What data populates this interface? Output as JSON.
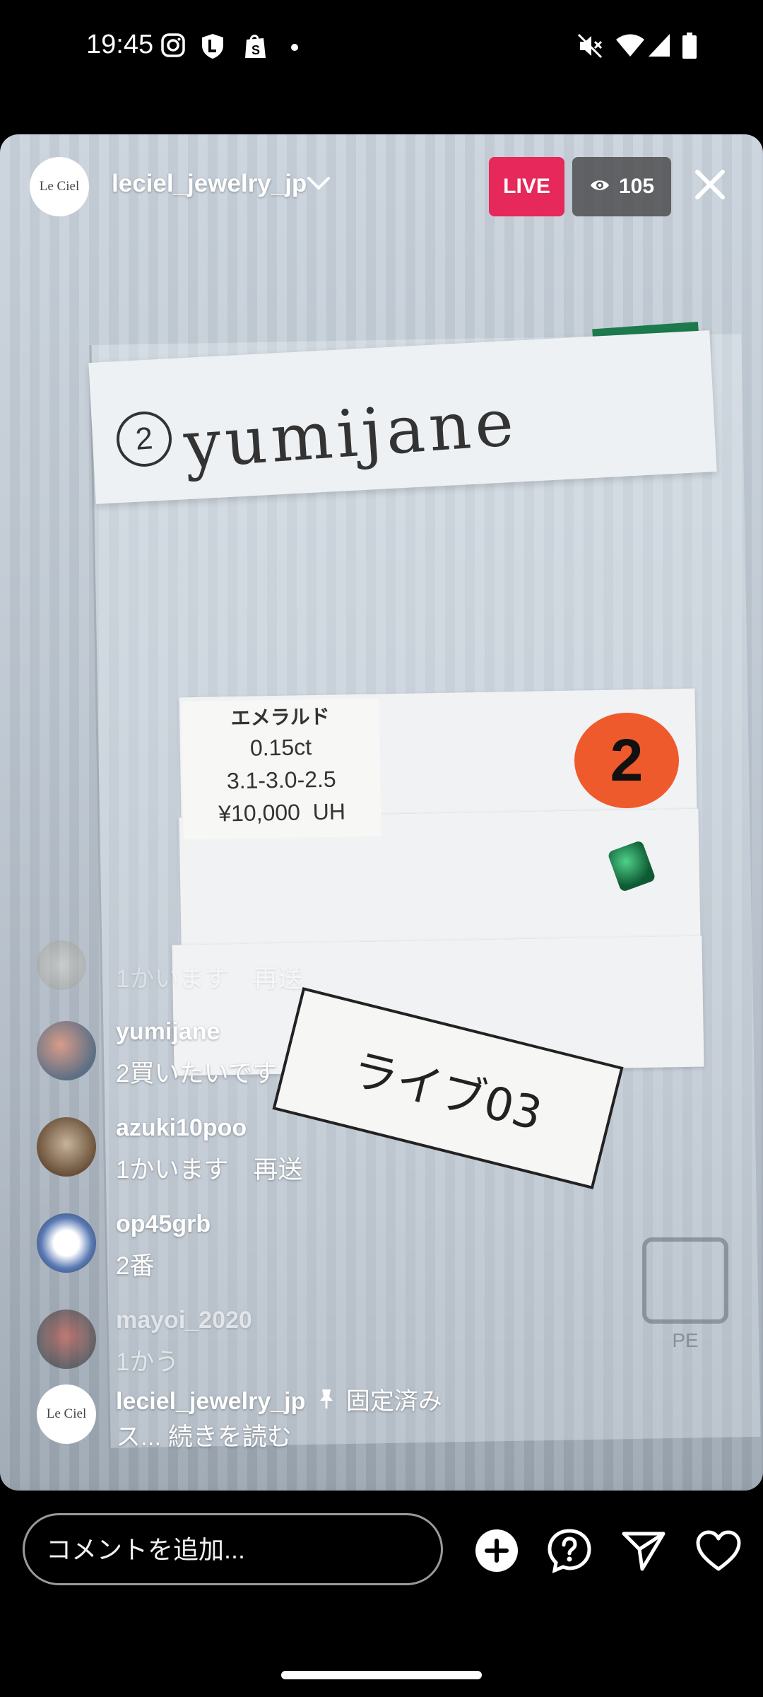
{
  "status_bar": {
    "time": "19:45",
    "left_icons": [
      "instagram-icon",
      "shield-l-icon",
      "shopify-bag-icon",
      "dot-icon"
    ],
    "right_icons": [
      "mute-icon",
      "wifi-icon",
      "signal-icon",
      "battery-icon"
    ]
  },
  "header": {
    "host_avatar_text": "Le Ciel",
    "host_username": "leciel_jewelry_jp",
    "live_label": "LIVE",
    "viewer_count": "105",
    "colors": {
      "live": "#e6285a"
    }
  },
  "video_scene": {
    "handwritten_name": "yumijane",
    "handwritten_number": "2",
    "price_label": [
      "エメラルド",
      "0.15ct",
      "3.1-3.0-2.5",
      "¥10,000  UH"
    ],
    "sticker_number": "2",
    "tag_text": "ライブ03",
    "recycle_text": "PE"
  },
  "comments": [
    {
      "username": "",
      "text": "1かいます　再送",
      "faded": true
    },
    {
      "username": "yumijane",
      "text": "2買いたいです"
    },
    {
      "username": "azuki10poo",
      "text": "1かいます　再送"
    },
    {
      "username": "op45grb",
      "text": "2番"
    },
    {
      "username": "mayoi_2020",
      "text": "1かう",
      "faded": true
    }
  ],
  "pinned_comment": {
    "username": "leciel_jewelry_jp",
    "pinned_label": "固定済み",
    "text": "ス... 続きを読む",
    "avatar_text": "Le Ciel"
  },
  "bottom_bar": {
    "comment_placeholder": "コメントを追加...",
    "icons": [
      "add-circle-icon",
      "question-bubble-icon",
      "send-icon",
      "heart-icon"
    ]
  }
}
